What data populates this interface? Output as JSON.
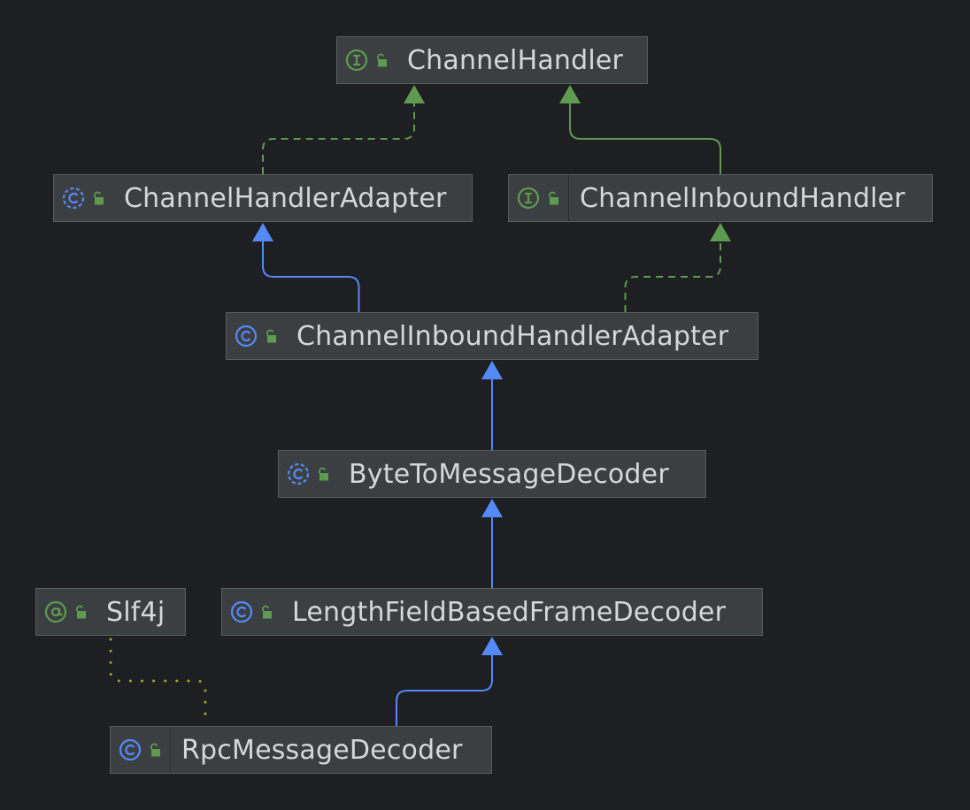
{
  "diagram": {
    "nodes": [
      {
        "id": "channel-handler",
        "label": "ChannelHandler",
        "kind": "interface",
        "icon": "interface-icon"
      },
      {
        "id": "channel-handler-adapter",
        "label": "ChannelHandlerAdapter",
        "kind": "abstract-class",
        "icon": "abstract-class-icon"
      },
      {
        "id": "channel-inbound-handler",
        "label": "ChannelInboundHandler",
        "kind": "interface",
        "icon": "interface-icon"
      },
      {
        "id": "channel-inbound-handler-adapter",
        "label": "ChannelInboundHandlerAdapter",
        "kind": "class",
        "icon": "class-icon"
      },
      {
        "id": "byte-to-message-decoder",
        "label": "ByteToMessageDecoder",
        "kind": "abstract-class",
        "icon": "abstract-class-icon"
      },
      {
        "id": "slf4j",
        "label": "Slf4j",
        "kind": "annotation",
        "icon": "annotation-icon"
      },
      {
        "id": "length-field-based-frame-decoder",
        "label": "LengthFieldBasedFrameDecoder",
        "kind": "class",
        "icon": "class-icon"
      },
      {
        "id": "rpc-message-decoder",
        "label": "RpcMessageDecoder",
        "kind": "class",
        "icon": "class-icon"
      }
    ],
    "edges": [
      {
        "from": "channel-handler-adapter",
        "to": "channel-handler",
        "type": "implements"
      },
      {
        "from": "channel-inbound-handler",
        "to": "channel-handler",
        "type": "extends-interface"
      },
      {
        "from": "channel-inbound-handler-adapter",
        "to": "channel-handler-adapter",
        "type": "extends"
      },
      {
        "from": "channel-inbound-handler-adapter",
        "to": "channel-inbound-handler",
        "type": "implements"
      },
      {
        "from": "byte-to-message-decoder",
        "to": "channel-inbound-handler-adapter",
        "type": "extends"
      },
      {
        "from": "length-field-based-frame-decoder",
        "to": "byte-to-message-decoder",
        "type": "extends"
      },
      {
        "from": "rpc-message-decoder",
        "to": "length-field-based-frame-decoder",
        "type": "extends"
      },
      {
        "from": "slf4j",
        "to": "rpc-message-decoder",
        "type": "annotated"
      }
    ],
    "colors": {
      "background": "#1e1f22",
      "node_fill": "#3c3f41",
      "node_border": "#5a5d60",
      "label_text": "#d5d7da",
      "class_blue": "#548af7",
      "interface_green": "#5e9b50",
      "lock_green": "#5e9b50",
      "edge_extends": "#548af7",
      "edge_implements": "#5e9b50",
      "edge_annotation": "#a6a51a"
    }
  }
}
